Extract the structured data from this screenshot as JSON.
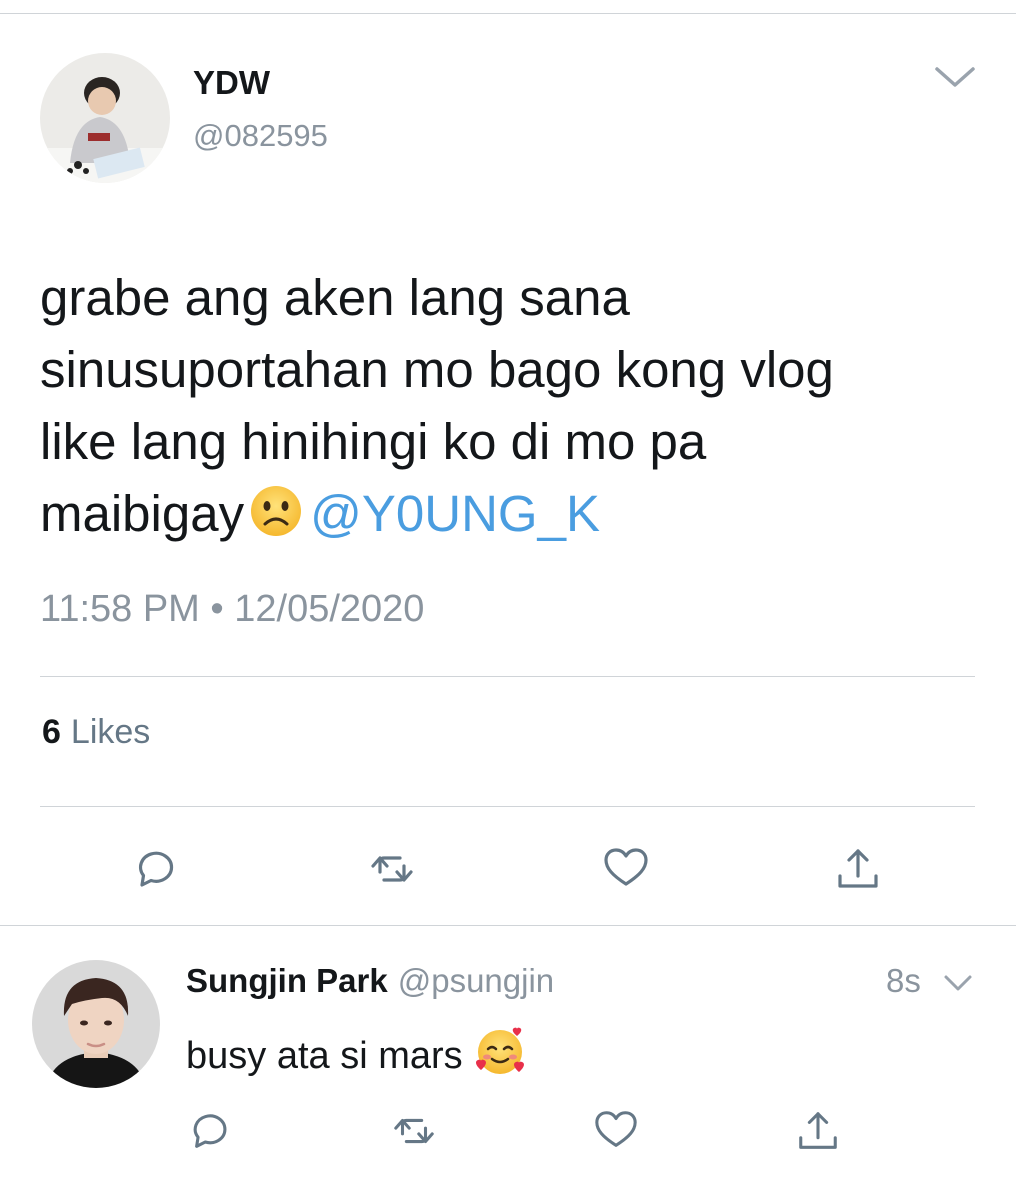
{
  "tweet": {
    "author": {
      "name": "YDW",
      "handle": "@082595",
      "avatar": "profile-photo"
    },
    "text_lines": [
      "grabe ang aken lang sana",
      "sinusuportahan mo bago kong vlog",
      "like lang hinihingi ko di mo pa",
      "maibigay"
    ],
    "emoji": "frowning-face-emoji",
    "mention": "@Y0UNG_K",
    "timestamp": "11:58 PM • 12/05/2020",
    "likes_count": "6",
    "likes_label": "Likes",
    "actions": [
      "reply-icon",
      "retweet-icon",
      "like-icon",
      "share-icon"
    ]
  },
  "reply": {
    "author": {
      "name": "Sungjin Park",
      "handle": "@psungjin",
      "avatar": "profile-photo"
    },
    "time": "8s",
    "text": "busy ata si mars",
    "emoji": "smiling-face-with-hearts-emoji",
    "actions": [
      "reply-icon",
      "retweet-icon",
      "like-icon",
      "share-icon"
    ]
  },
  "colors": {
    "link": "#4a9de0",
    "secondary_text": "#8a949e",
    "icon": "#657786",
    "divider": "#d0d4d8"
  }
}
